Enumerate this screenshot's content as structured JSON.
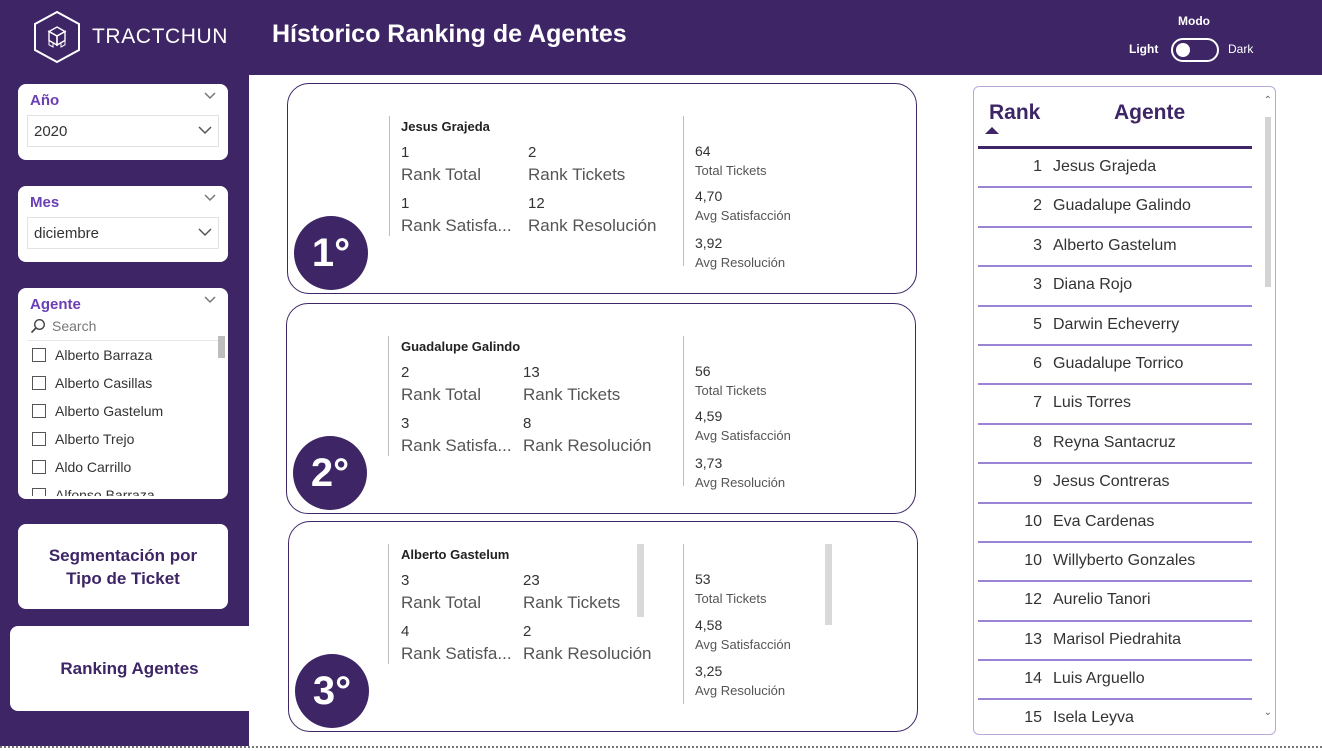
{
  "brand": {
    "name": "TRACTCHUN"
  },
  "header": {
    "title": "Hístorico Ranking de Agentes",
    "mode_label": "Modo",
    "light_label": "Light",
    "dark_label": "Dark"
  },
  "filters": {
    "year": {
      "label": "Año",
      "value": "2020"
    },
    "month": {
      "label": "Mes",
      "value": "diciembre"
    },
    "agent": {
      "label": "Agente",
      "search_placeholder": "Search",
      "options": [
        "Alberto Barraza",
        "Alberto Casillas",
        "Alberto Gastelum",
        "Alberto Trejo",
        "Aldo Carrillo",
        "Alfonso Barraza"
      ]
    }
  },
  "nav": {
    "segmentacion": "Segmentación por Tipo de Ticket",
    "ranking": "Ranking Agentes"
  },
  "cards": [
    {
      "badge": "1°",
      "name": "Jesus Grajeda",
      "rank_total": "1",
      "rank_total_label": "Rank Total",
      "rank_tickets": "2",
      "rank_tickets_label": "Rank Tickets",
      "rank_satisf": "1",
      "rank_satisf_label": "Rank Satisfa...",
      "rank_resol": "12",
      "rank_resol_label": "Rank Resolución",
      "total_tickets": "64",
      "total_tickets_label": "Total Tickets",
      "avg_satisf": "4,70",
      "avg_satisf_label": "Avg Satisfacción",
      "avg_resol": "3,92",
      "avg_resol_label": "Avg Resolución"
    },
    {
      "badge": "2°",
      "name": "Guadalupe Galindo",
      "rank_total": "2",
      "rank_total_label": "Rank Total",
      "rank_tickets": "13",
      "rank_tickets_label": "Rank Tickets",
      "rank_satisf": "3",
      "rank_satisf_label": "Rank Satisfa...",
      "rank_resol": "8",
      "rank_resol_label": "Rank Resolución",
      "total_tickets": "56",
      "total_tickets_label": "Total Tickets",
      "avg_satisf": "4,59",
      "avg_satisf_label": "Avg Satisfacción",
      "avg_resol": "3,73",
      "avg_resol_label": "Avg Resolución"
    },
    {
      "badge": "3°",
      "name": "Alberto Gastelum",
      "rank_total": "3",
      "rank_total_label": "Rank Total",
      "rank_tickets": "23",
      "rank_tickets_label": "Rank Tickets",
      "rank_satisf": "4",
      "rank_satisf_label": "Rank Satisfa...",
      "rank_resol": "2",
      "rank_resol_label": "Rank Resolución",
      "total_tickets": "53",
      "total_tickets_label": "Total Tickets",
      "avg_satisf": "4,58",
      "avg_satisf_label": "Avg Satisfacción",
      "avg_resol": "3,25",
      "avg_resol_label": "Avg Resolución"
    }
  ],
  "table": {
    "col_rank": "Rank",
    "col_agente": "Agente",
    "rows": [
      {
        "rank": "1",
        "agente": "Jesus Grajeda"
      },
      {
        "rank": "2",
        "agente": "Guadalupe Galindo"
      },
      {
        "rank": "3",
        "agente": "Alberto Gastelum"
      },
      {
        "rank": "3",
        "agente": "Diana Rojo"
      },
      {
        "rank": "5",
        "agente": "Darwin Echeverry"
      },
      {
        "rank": "6",
        "agente": "Guadalupe Torrico"
      },
      {
        "rank": "7",
        "agente": "Luis Torres"
      },
      {
        "rank": "8",
        "agente": "Reyna Santacruz"
      },
      {
        "rank": "9",
        "agente": "Jesus Contreras"
      },
      {
        "rank": "10",
        "agente": "Eva Cardenas"
      },
      {
        "rank": "10",
        "agente": "Willyberto Gonzales"
      },
      {
        "rank": "12",
        "agente": "Aurelio Tanori"
      },
      {
        "rank": "13",
        "agente": "Marisol Piedrahita"
      },
      {
        "rank": "14",
        "agente": "Luis Arguello"
      },
      {
        "rank": "15",
        "agente": "Isela Leyva"
      }
    ]
  },
  "colors": {
    "primary": "#3d2566",
    "accent": "#6a3fb3",
    "row_line": "#9b84d6"
  }
}
